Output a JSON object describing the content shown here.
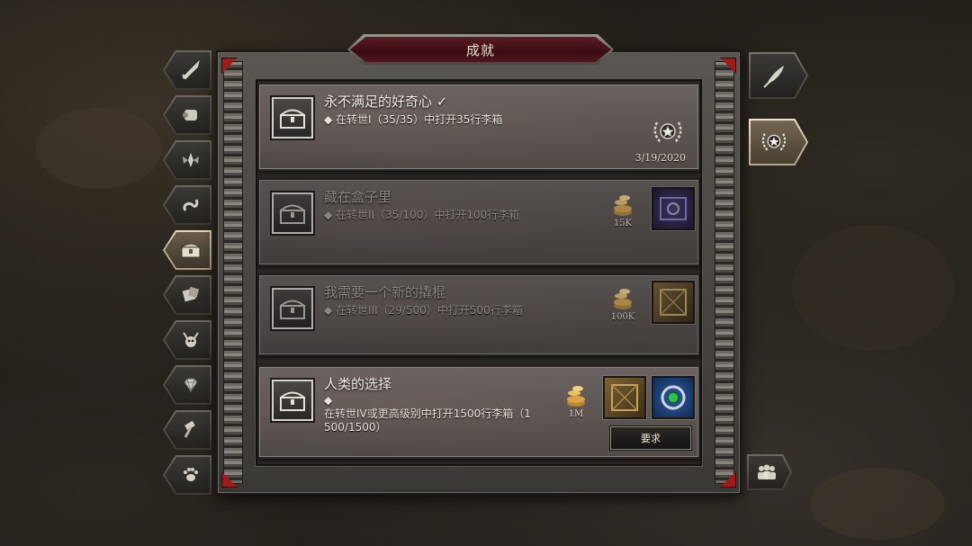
{
  "window": {
    "title": "成就"
  },
  "categories": [
    {
      "icon": "sword-icon",
      "active": false
    },
    {
      "icon": "scroll-icon",
      "active": false
    },
    {
      "icon": "wings-icon",
      "active": false
    },
    {
      "icon": "serpent-icon",
      "active": false
    },
    {
      "icon": "chest-icon",
      "active": true
    },
    {
      "icon": "dice-icon",
      "active": false
    },
    {
      "icon": "demon-skull-icon",
      "active": false
    },
    {
      "icon": "gem-icon",
      "active": false
    },
    {
      "icon": "hammer-icon",
      "active": false
    },
    {
      "icon": "paw-icon",
      "active": false
    }
  ],
  "achievements": [
    {
      "title": "永不满足的好奇心 ✓",
      "desc": "◆ 在转世I（35/35）中打开35行李箱",
      "date": "3/19/2020",
      "completed": true
    },
    {
      "title": "藏在盒子里",
      "desc": "◆ 在转世II（35/100）中打开100行李箱",
      "gold": "15K",
      "completed": false
    },
    {
      "title": "我需要一个新的撬棍",
      "desc": "◆ 在转世III（29/500）中打开500行李箱",
      "gold": "100K",
      "completed": false
    },
    {
      "title": "人类的选择",
      "desc_line1": "◆",
      "desc_line2": "在转世IV或更高级别中打开1500行李箱（1",
      "desc_line3": "500/1500）",
      "gold": "1M",
      "button": "要求",
      "completed": true
    }
  ],
  "right_tabs": [
    {
      "icon": "quill-icon",
      "active": false
    },
    {
      "icon": "laurel-star-icon",
      "active": true
    }
  ],
  "social": {
    "icon": "group-icon"
  },
  "colors": {
    "accent_red": "#a01a1a",
    "title_plate": "#5b1b22",
    "gold": "#d9a441"
  }
}
